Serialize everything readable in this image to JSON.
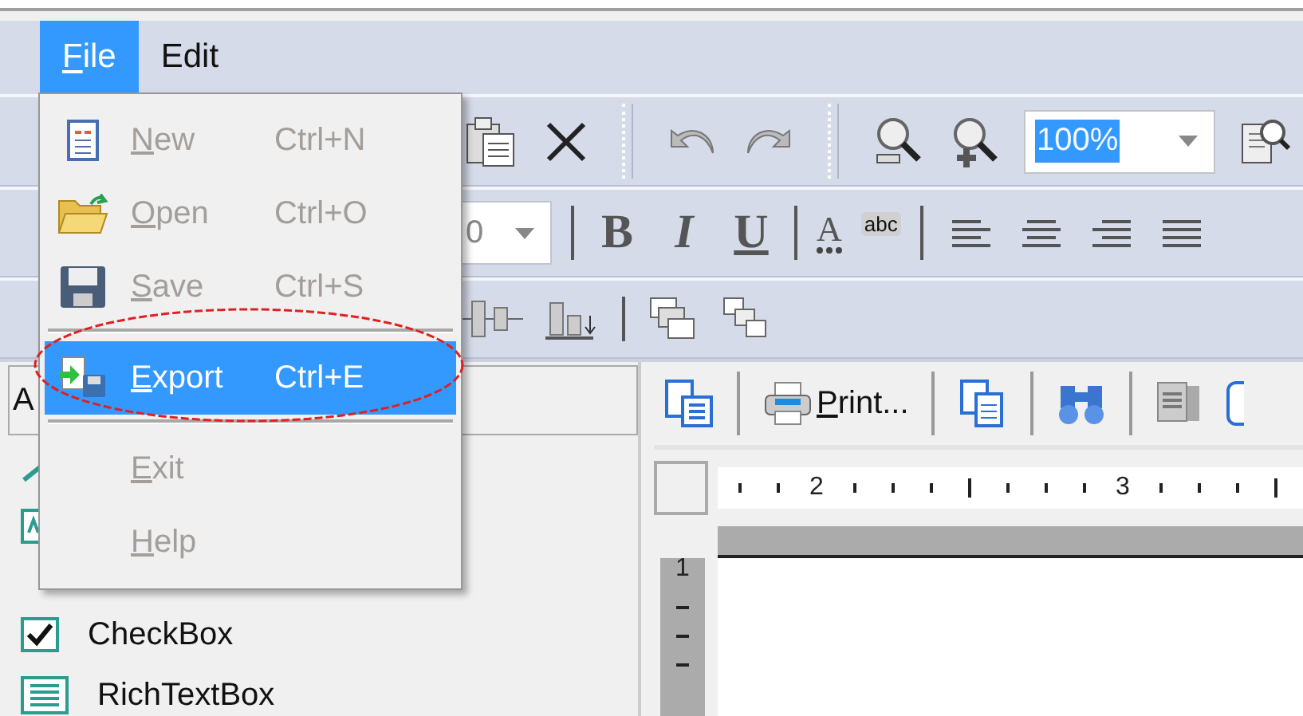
{
  "menu_bar": [
    {
      "label": "File",
      "selected": true
    },
    {
      "label": "Edit",
      "selected": false
    }
  ],
  "file_menu": [
    {
      "kind": "item",
      "label": "New",
      "shortcut": "Ctrl+N",
      "disabled": true,
      "selected": false
    },
    {
      "kind": "item",
      "label": "Open",
      "shortcut": "Ctrl+O",
      "disabled": true,
      "selected": false
    },
    {
      "kind": "item",
      "label": "Save",
      "shortcut": "Ctrl+S",
      "disabled": true,
      "selected": false
    },
    {
      "kind": "separator"
    },
    {
      "kind": "item",
      "label": "Export",
      "shortcut": "Ctrl+E",
      "disabled": false,
      "selected": true
    },
    {
      "kind": "separator"
    },
    {
      "kind": "item",
      "label": "Exit",
      "disabled": true,
      "selected": false
    },
    {
      "kind": "item",
      "label": "Help",
      "disabled": true,
      "selected": false
    }
  ],
  "standard_toolbar": {
    "zoom_combo": {
      "value": "100%",
      "text_selected": true
    }
  },
  "format_toolbar": {
    "font_size_combo": {
      "value": "0"
    },
    "style_buttons": [
      "B",
      "I",
      "U"
    ],
    "font_color_letter": "A",
    "highlight_text": "abc"
  },
  "toolbox": {
    "header": "A",
    "items": [
      {
        "label": "CheckBox"
      },
      {
        "label": "RichTextBox"
      }
    ]
  },
  "preview_toolbar": {
    "print_button": "Print..."
  },
  "ruler": {
    "horizontal_labels": [
      "2",
      "3"
    ],
    "vertical_labels": [
      "1"
    ]
  }
}
